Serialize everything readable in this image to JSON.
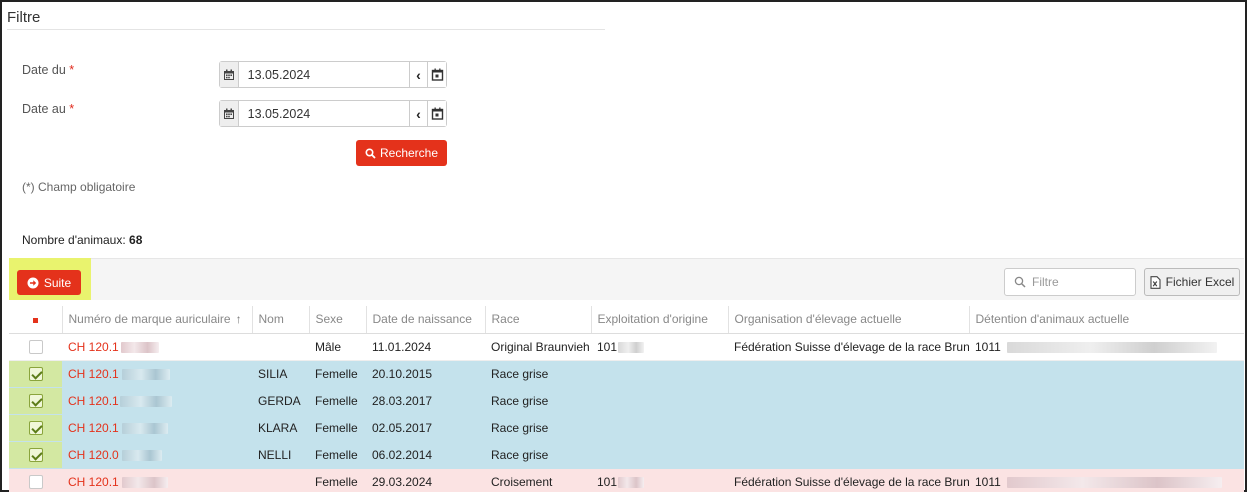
{
  "filter": {
    "title": "Filtre",
    "date_from_label": "Date du",
    "date_to_label": "Date au",
    "required_mark": "*",
    "date_from_value": "13.05.2024",
    "date_to_value": "13.05.2024",
    "search_label": "Recherche",
    "required_hint": "(*) Champ obligatoire"
  },
  "summary": {
    "count_label": "Nombre d'animaux:",
    "count_value": "68"
  },
  "toolbar": {
    "suite_label": "Suite",
    "filter_placeholder": "Filtre",
    "excel_label": "Fichier Excel"
  },
  "table": {
    "headers": [
      "Numéro de marque auriculaire",
      "Nom",
      "Sexe",
      "Date de naissance",
      "Race",
      "Exploitation d'origine",
      "Organisation d'élevage actuelle",
      "Détention d'animaux actuelle"
    ],
    "sort_indicator": "↑",
    "rows": [
      {
        "tag": "CH 120.1",
        "name": "",
        "sex": "Mâle",
        "birth": "11.01.2024",
        "race": "Original Braunvieh",
        "origin": "101",
        "org": "Fédération Suisse d'élevage de la race Brune",
        "holding": "1011",
        "checked": false,
        "state": "normal"
      },
      {
        "tag": "CH 120.1",
        "name": "SILIA",
        "sex": "Femelle",
        "birth": "20.10.2015",
        "race": "Race grise",
        "origin": "",
        "org": "",
        "holding": "",
        "checked": true,
        "state": "selected"
      },
      {
        "tag": "CH 120.1",
        "name": "GERDA",
        "sex": "Femelle",
        "birth": "28.03.2017",
        "race": "Race grise",
        "origin": "",
        "org": "",
        "holding": "",
        "checked": true,
        "state": "selected"
      },
      {
        "tag": "CH 120.1",
        "name": "KLARA",
        "sex": "Femelle",
        "birth": "02.05.2017",
        "race": "Race grise",
        "origin": "",
        "org": "",
        "holding": "",
        "checked": true,
        "state": "selected"
      },
      {
        "tag": "CH 120.0",
        "name": "NELLI",
        "sex": "Femelle",
        "birth": "06.02.2014",
        "race": "Race grise",
        "origin": "",
        "org": "",
        "holding": "",
        "checked": true,
        "state": "selected"
      },
      {
        "tag": "CH 120.1",
        "name": "",
        "sex": "Femelle",
        "birth": "29.03.2024",
        "race": "Croisement",
        "origin": "101",
        "org": "Fédération Suisse d'élevage de la race Brune",
        "holding": "1011",
        "checked": false,
        "state": "pink"
      }
    ]
  }
}
